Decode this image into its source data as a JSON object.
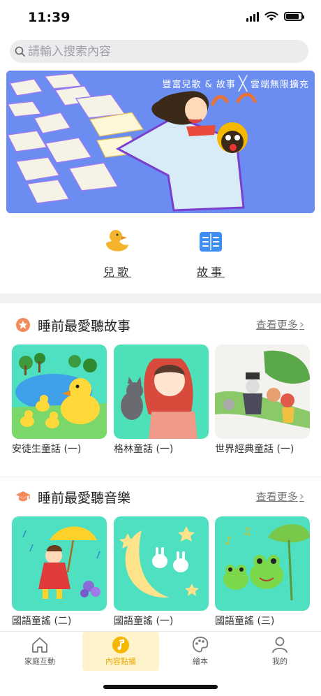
{
  "status": {
    "time": "11:39"
  },
  "search": {
    "placeholder": "請輸入搜索內容"
  },
  "banner": {
    "left_text": "豐富兒歌 & 故事",
    "right_text": "雲端無限擴充"
  },
  "quick": [
    {
      "label": "兒歌",
      "icon": "duck-icon"
    },
    {
      "label": "故事",
      "icon": "book-icon"
    }
  ],
  "sections": [
    {
      "title": "睡前最愛聽故事",
      "more": "查看更多",
      "icon": "star-badge-icon",
      "items": [
        {
          "caption": "安徒生童話 (一)"
        },
        {
          "caption": "格林童話 (一)"
        },
        {
          "caption": "世界經典童話 (一)"
        }
      ]
    },
    {
      "title": "睡前最愛聽音樂",
      "more": "查看更多",
      "icon": "graduation-cap-icon",
      "items": [
        {
          "caption": "國語童謠 (二)"
        },
        {
          "caption": "國語童謠 (一)"
        },
        {
          "caption": "國語童謠 (三)"
        }
      ]
    }
  ],
  "tabs": [
    {
      "label": "家庭互動",
      "icon": "house-icon",
      "active": false
    },
    {
      "label": "內容點播",
      "icon": "music-note-icon",
      "active": true
    },
    {
      "label": "繪本",
      "icon": "palette-icon",
      "active": false
    },
    {
      "label": "我的",
      "icon": "user-icon",
      "active": false
    }
  ],
  "colors": {
    "accent": "#f5b800",
    "banner_bg": "#6b8cf0",
    "card_bg": "#4ee0c0"
  }
}
